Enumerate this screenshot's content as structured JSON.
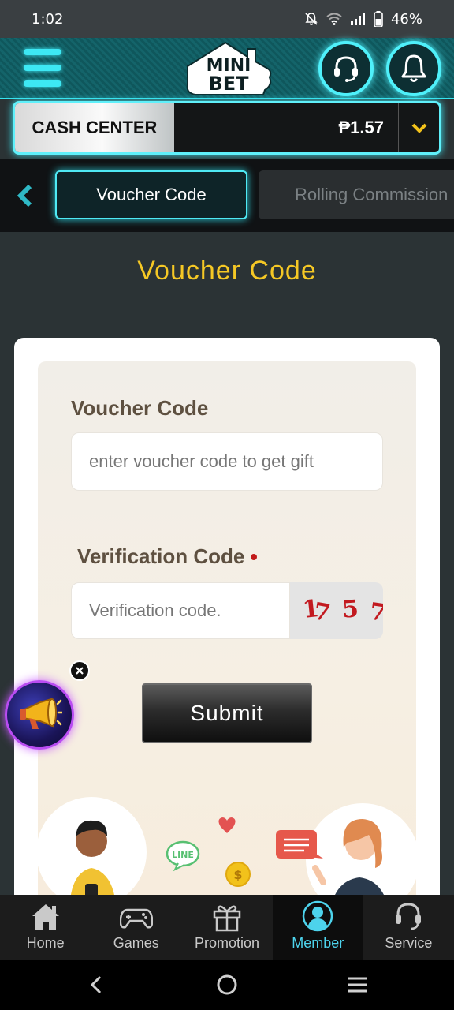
{
  "status_bar": {
    "time": "1:02",
    "battery": "46%"
  },
  "header": {
    "logo_line1": "MINI",
    "logo_line2": "BET",
    "menu_icon": "hamburger-icon",
    "support_icon": "headset-icon",
    "notification_icon": "bell-icon"
  },
  "cash_center": {
    "label": "CASH CENTER",
    "amount": "₱1.57"
  },
  "tabs": [
    {
      "label": "Voucher Code",
      "active": true
    },
    {
      "label": "Rolling Commission",
      "active": false
    }
  ],
  "page": {
    "title": "Voucher Code"
  },
  "form": {
    "voucher_label": "Voucher Code",
    "voucher_placeholder": "enter voucher code to get gift",
    "verification_label": "Verification Code",
    "verification_placeholder": "Verification code.",
    "captcha": [
      "1",
      "7",
      "5",
      "7"
    ],
    "submit_label": "Submit"
  },
  "illustration": {
    "chat_badge": "LINE"
  },
  "bottom_nav": [
    {
      "label": "Home",
      "icon": "home-icon",
      "active": false
    },
    {
      "label": "Games",
      "icon": "gamepad-icon",
      "active": false
    },
    {
      "label": "Promotion",
      "icon": "gift-icon",
      "active": false
    },
    {
      "label": "Member",
      "icon": "user-icon",
      "active": true
    },
    {
      "label": "Service",
      "icon": "headset-icon",
      "active": false
    }
  ],
  "colors": {
    "accent_cyan": "#4feaf5",
    "title_yellow": "#f5c825",
    "label_brown": "#5e5040",
    "captcha_red": "#c2191f",
    "active_nav": "#4dd3ec"
  }
}
